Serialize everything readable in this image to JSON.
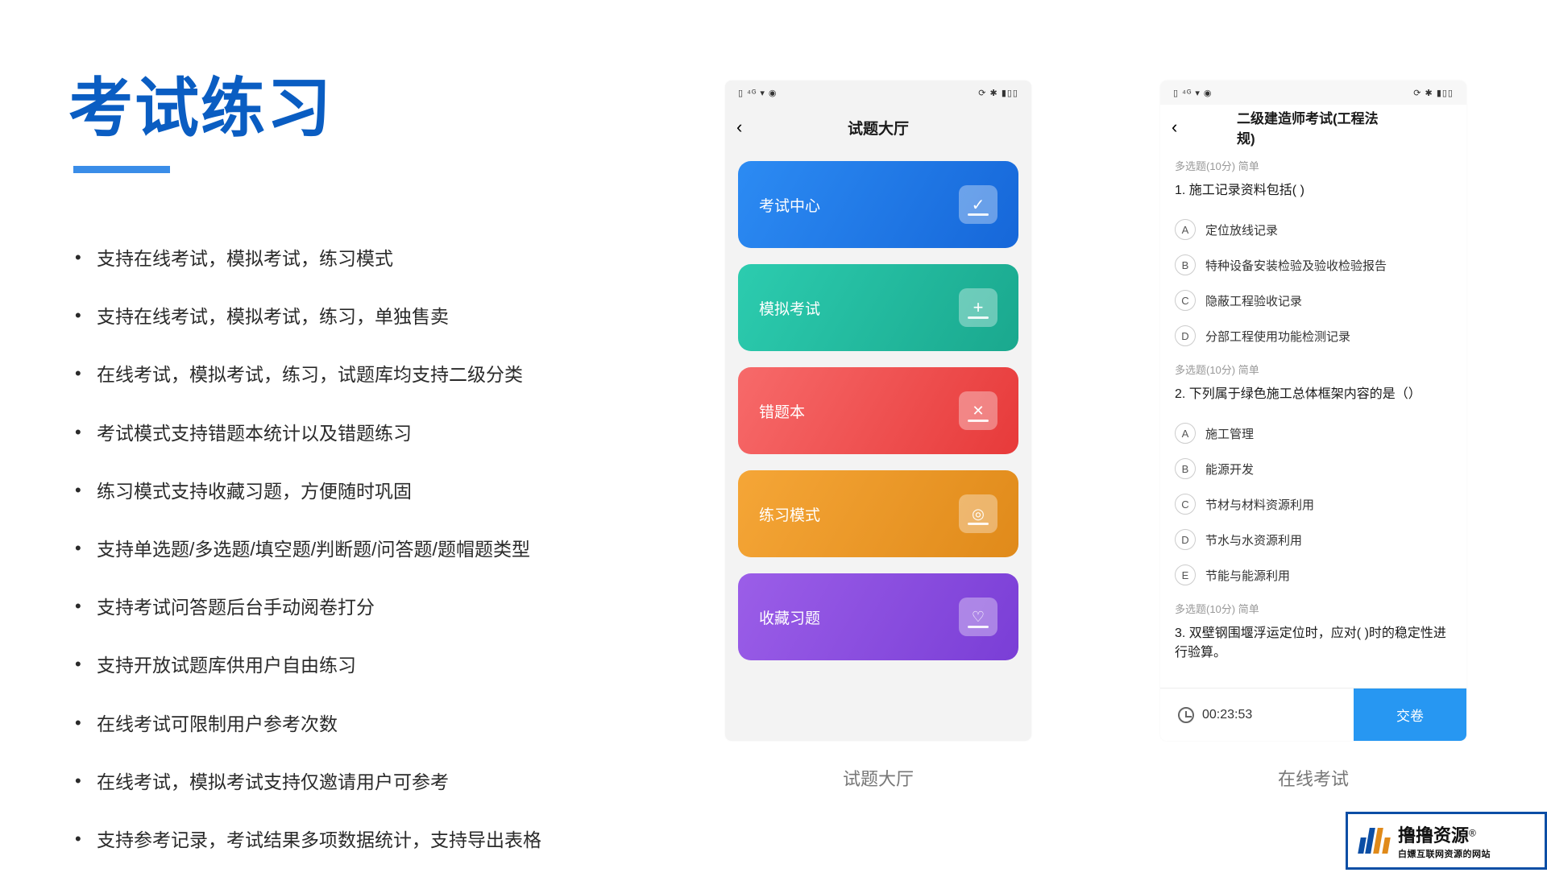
{
  "title": "考试练习",
  "bullets": [
    "支持在线考试，模拟考试，练习模式",
    "支持在线考试，模拟考试，练习，单独售卖",
    "在线考试，模拟考试，练习，试题库均支持二级分类",
    "考试模式支持错题本统计以及错题练习",
    "练习模式支持收藏习题，方便随时巩固",
    "支持单选题/多选题/填空题/判断题/问答题/题帽题类型",
    "支持考试问答题后台手动阅卷打分",
    "支持开放试题库供用户自由练习",
    "在线考试可限制用户参考次数",
    "在线考试，模拟考试支持仅邀请用户可参考",
    "支持参考记录，考试结果多项数据统计，支持导出表格"
  ],
  "phone1": {
    "title": "试题大厅",
    "cards": [
      {
        "label": "考试中心"
      },
      {
        "label": "模拟考试"
      },
      {
        "label": "错题本"
      },
      {
        "label": "练习模式"
      },
      {
        "label": "收藏习题"
      }
    ],
    "caption": "试题大厅"
  },
  "phone2": {
    "title": "二级建造师考试(工程法规)",
    "q1": {
      "meta": "多选题(10分)  简单",
      "text": "1. 施工记录资料包括( )",
      "opts": [
        {
          "k": "A",
          "t": "定位放线记录"
        },
        {
          "k": "B",
          "t": "特种设备安装检验及验收检验报告"
        },
        {
          "k": "C",
          "t": "隐蔽工程验收记录"
        },
        {
          "k": "D",
          "t": "分部工程使用功能检测记录"
        }
      ]
    },
    "q2": {
      "meta": "多选题(10分)  简单",
      "text": "2. 下列属于绿色施工总体框架内容的是（）",
      "opts": [
        {
          "k": "A",
          "t": "施工管理"
        },
        {
          "k": "B",
          "t": "能源开发"
        },
        {
          "k": "C",
          "t": "节材与材料资源利用"
        },
        {
          "k": "D",
          "t": "节水与水资源利用"
        },
        {
          "k": "E",
          "t": "节能与能源利用"
        }
      ]
    },
    "q3": {
      "meta": "多选题(10分)  简单",
      "text": "3. 双壁钢围堰浮运定位时，应对(  )时的稳定性进行验算。"
    },
    "timer": "00:23:53",
    "submit": "交卷",
    "caption": "在线考试"
  },
  "logo": {
    "main": "撸撸资源",
    "r": "®",
    "sub": "白嫖互联网资源的网站"
  }
}
